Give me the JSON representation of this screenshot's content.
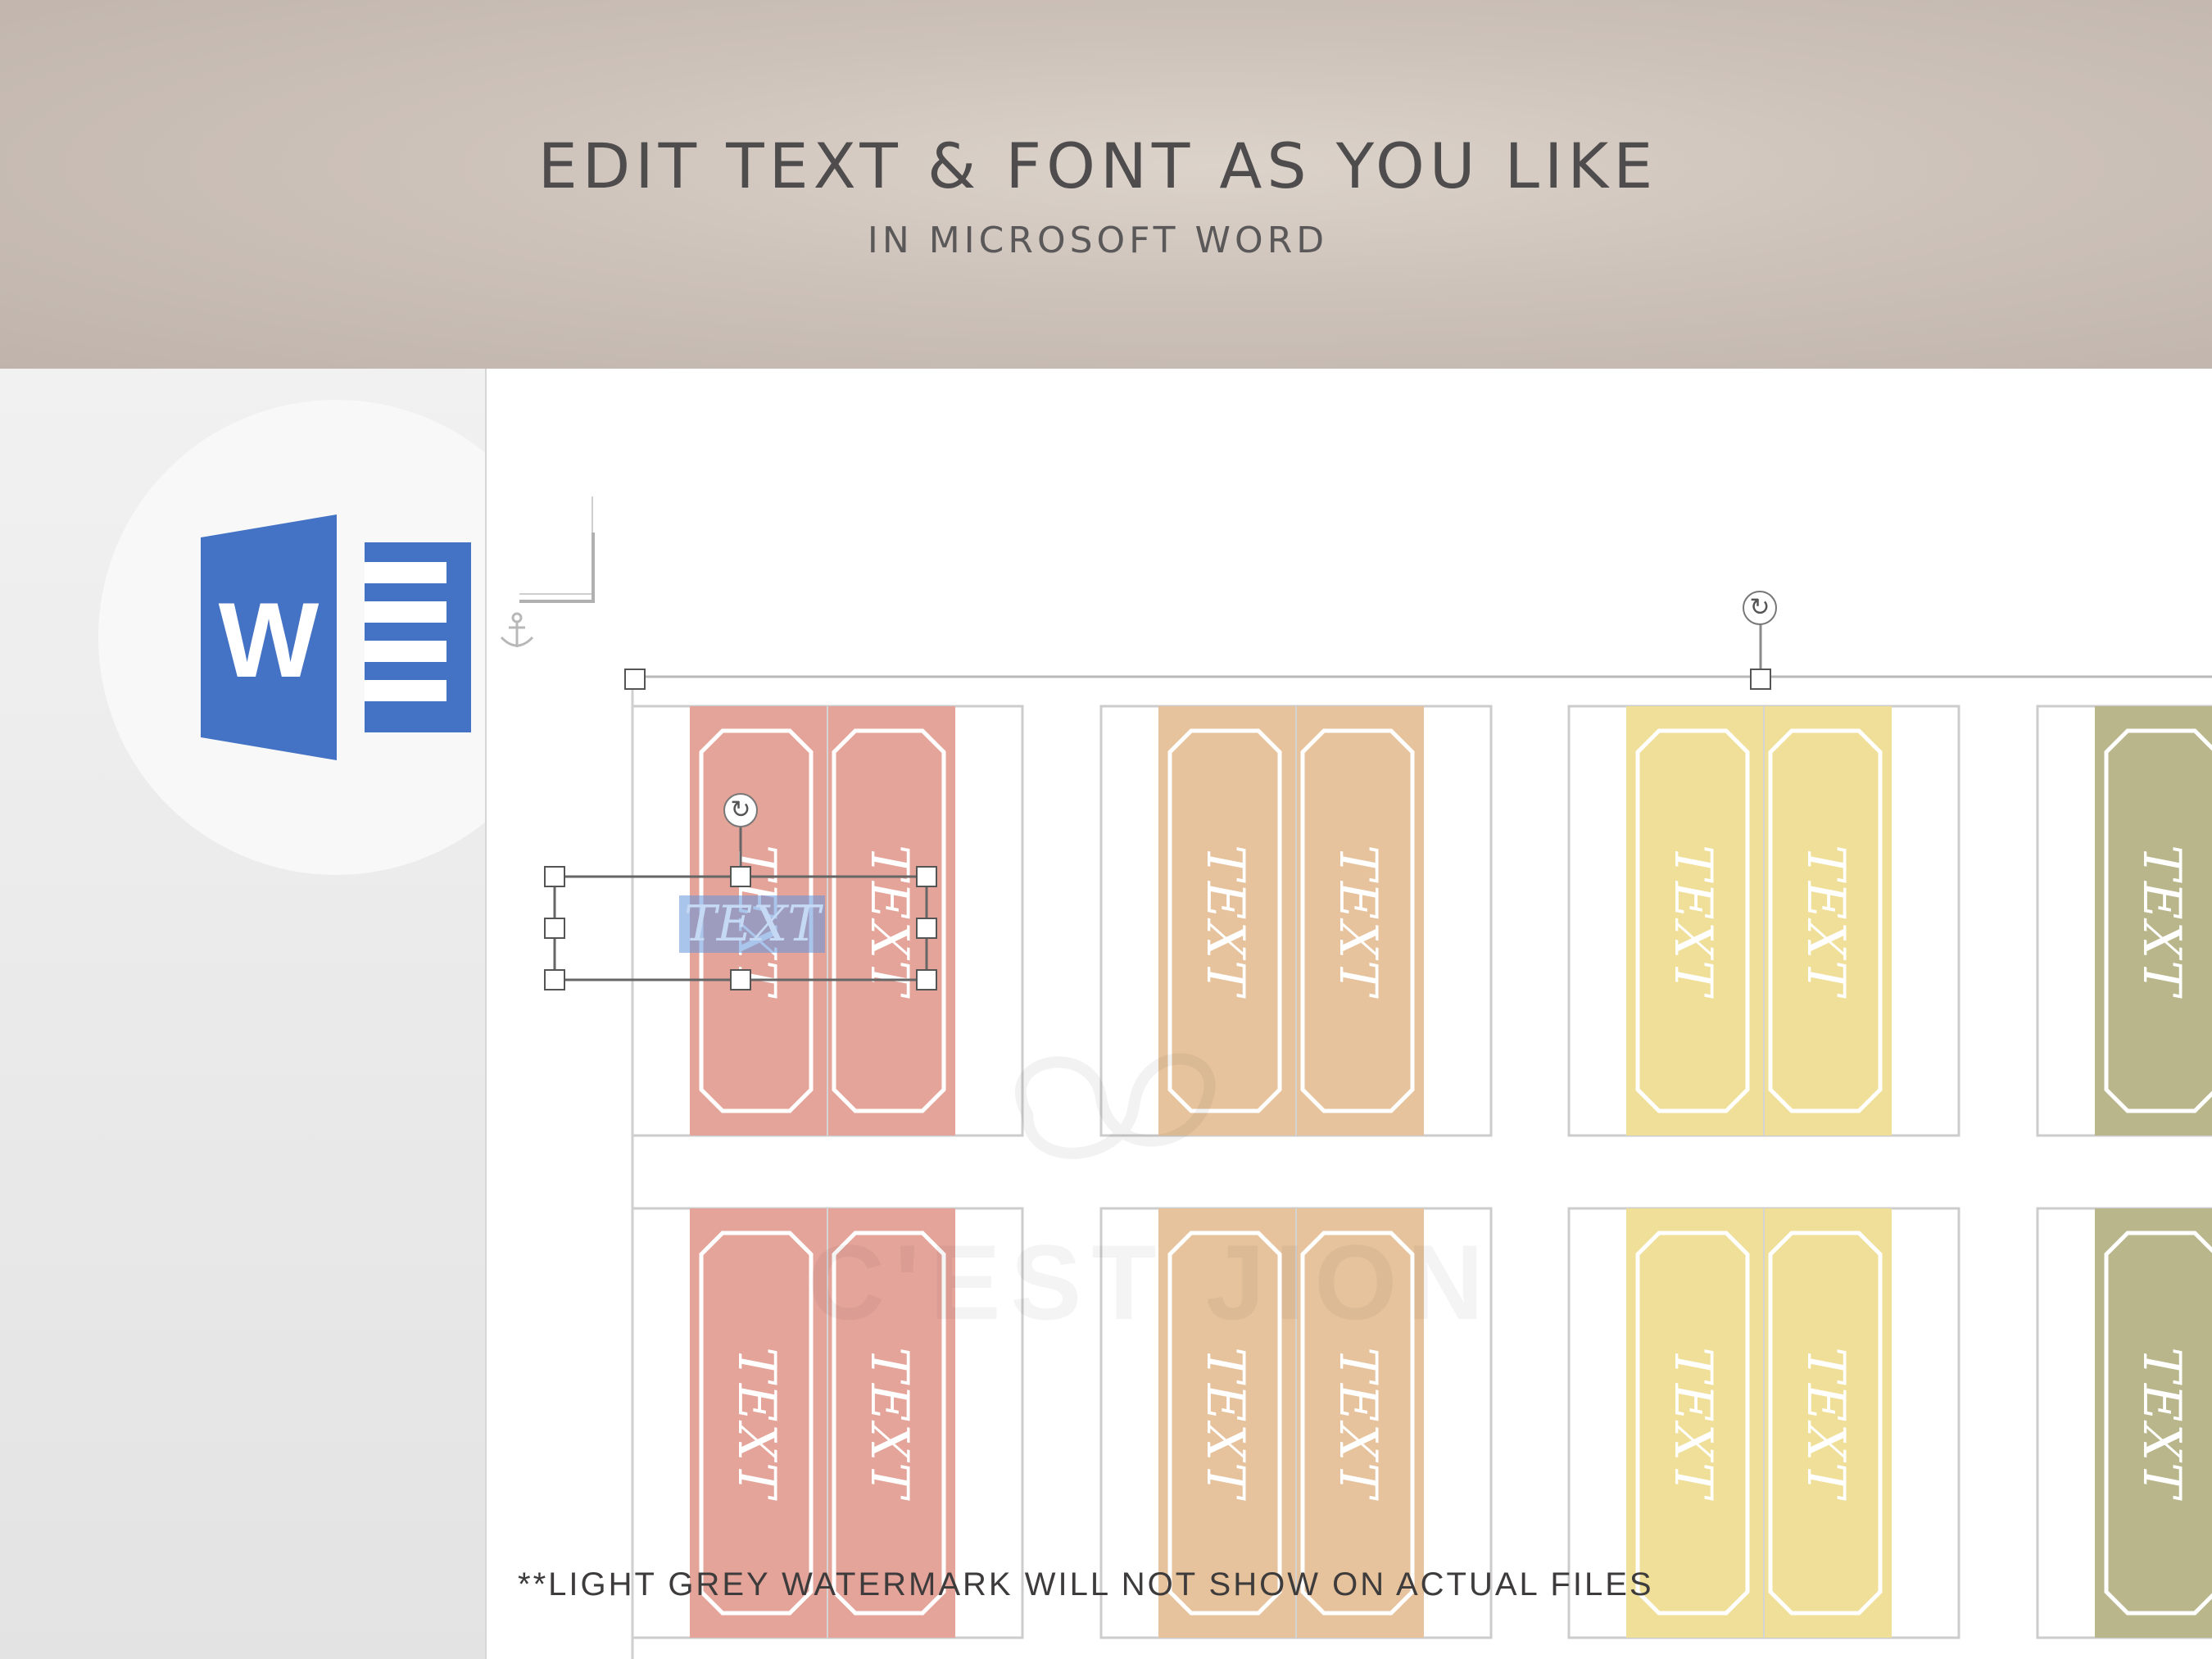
{
  "banner": {
    "title": "EDIT TEXT & FONT AS YOU LIKE",
    "subtitle": "IN MICROSOFT WORD"
  },
  "logo": {
    "letter": "W",
    "name": "word-logo"
  },
  "colors": {
    "coral": "#e4a49a",
    "peach": "#e6c39d",
    "yellow": "#efdf99",
    "olive": "#b8b68a",
    "logo_blue": "#4472c4",
    "selection": "#6496dc"
  },
  "bookmark_text": "TEXT",
  "selected_text": "TEXT",
  "rows": [
    {
      "groups": [
        {
          "color": "coral",
          "labels": [
            "TEXT",
            "TEXT"
          ]
        },
        {
          "color": "peach",
          "labels": [
            "TEXT",
            "TEXT"
          ]
        },
        {
          "color": "yellow",
          "labels": [
            "TEXT",
            "TEXT"
          ]
        },
        {
          "color": "olive",
          "labels": [
            "TEXT"
          ]
        }
      ]
    },
    {
      "groups": [
        {
          "color": "coral",
          "labels": [
            "TEXT",
            "TEXT"
          ]
        },
        {
          "color": "peach",
          "labels": [
            "TEXT",
            "TEXT"
          ]
        },
        {
          "color": "yellow",
          "labels": [
            "TEXT",
            "TEXT"
          ]
        },
        {
          "color": "olive",
          "labels": [
            "TEXT"
          ]
        }
      ]
    }
  ],
  "watermark": {
    "text": "C'EST JION"
  },
  "note": "**LIGHT GREY WATERMARK WILL NOT SHOW ON ACTUAL FILES",
  "icons": [
    "anchor-icon",
    "rotate-handle-icon",
    "resize-handle-icon"
  ]
}
